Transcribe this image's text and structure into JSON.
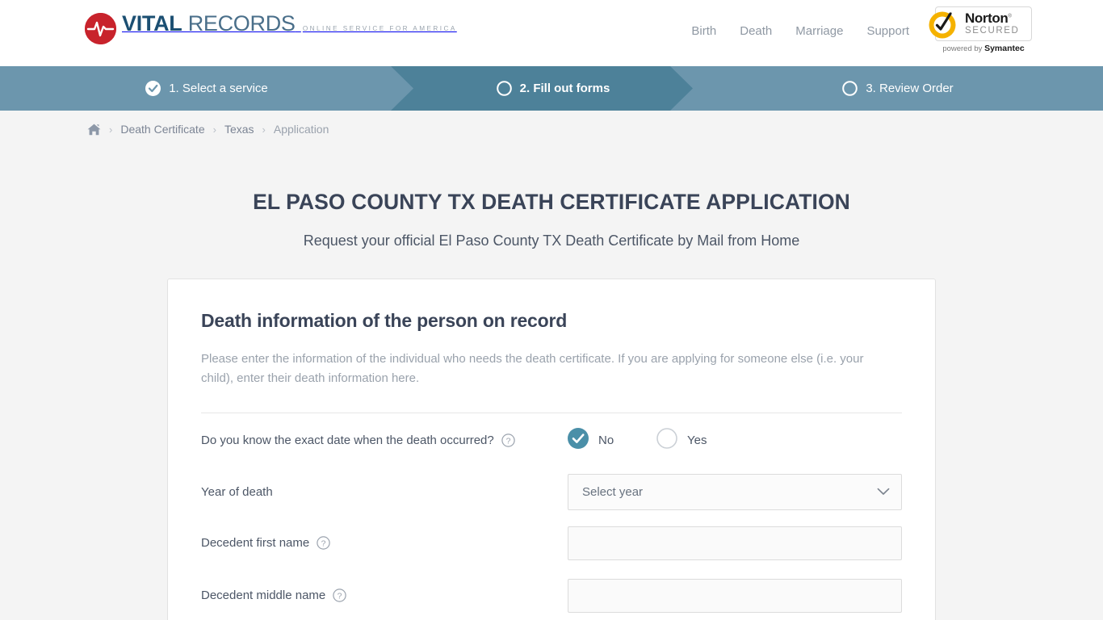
{
  "header": {
    "logo": {
      "brand_primary": "VITAL",
      "brand_secondary": " RECORDS",
      "tagline": "ONLINE SERVICE FOR AMERICA",
      "mark_color": "#c8232c",
      "primary_color": "#1b4f72",
      "secondary_color": "#4a6f8a"
    },
    "nav": [
      {
        "label": "Birth"
      },
      {
        "label": "Death"
      },
      {
        "label": "Marriage"
      },
      {
        "label": "Support"
      }
    ],
    "trust_badge": {
      "name": "Norton",
      "registered_mark": "®",
      "status": "SECURED",
      "powered_prefix": "powered by ",
      "powered_brand": "Symantec",
      "seal_color": "#f5b200"
    }
  },
  "steps": {
    "bar_color": "#6c96ad",
    "active_color": "#4d8199",
    "items": [
      {
        "label": "1. Select a service",
        "state": "complete",
        "icon": "check-circle-icon"
      },
      {
        "label": "2. Fill out forms",
        "state": "active",
        "icon": "circle-icon"
      },
      {
        "label": "3. Review Order",
        "state": "pending",
        "icon": "circle-icon"
      }
    ]
  },
  "breadcrumb": {
    "home_icon": "home-icon",
    "separator": "›",
    "items": [
      {
        "label": "Death Certificate",
        "current": false
      },
      {
        "label": "Texas",
        "current": false
      },
      {
        "label": "Application",
        "current": true
      }
    ]
  },
  "page": {
    "title": "EL PASO COUNTY TX DEATH CERTIFICATE APPLICATION",
    "subtitle": "Request your official El Paso County TX Death Certificate by Mail from Home"
  },
  "card": {
    "title": "Death information of the person on record",
    "description": "Please enter the information of the individual who needs the death certificate. If you are applying for someone else (i.e. your child), enter their death information here.",
    "fields": {
      "exact_date": {
        "label": "Do you know the exact date when the death occurred?",
        "help_icon": "help-circle-icon",
        "options": [
          {
            "label": "No",
            "selected": true
          },
          {
            "label": "Yes",
            "selected": false
          }
        ],
        "selected_color": "#4a8fa8"
      },
      "year_of_death": {
        "label": "Year of death",
        "value": "Select year",
        "chevron_icon": "chevron-down-icon"
      },
      "first_name": {
        "label": "Decedent first name",
        "help_icon": "help-circle-icon",
        "value": "",
        "placeholder": ""
      },
      "middle_name": {
        "label": "Decedent middle name",
        "help_icon": "help-circle-icon",
        "value": "",
        "placeholder": ""
      }
    }
  }
}
